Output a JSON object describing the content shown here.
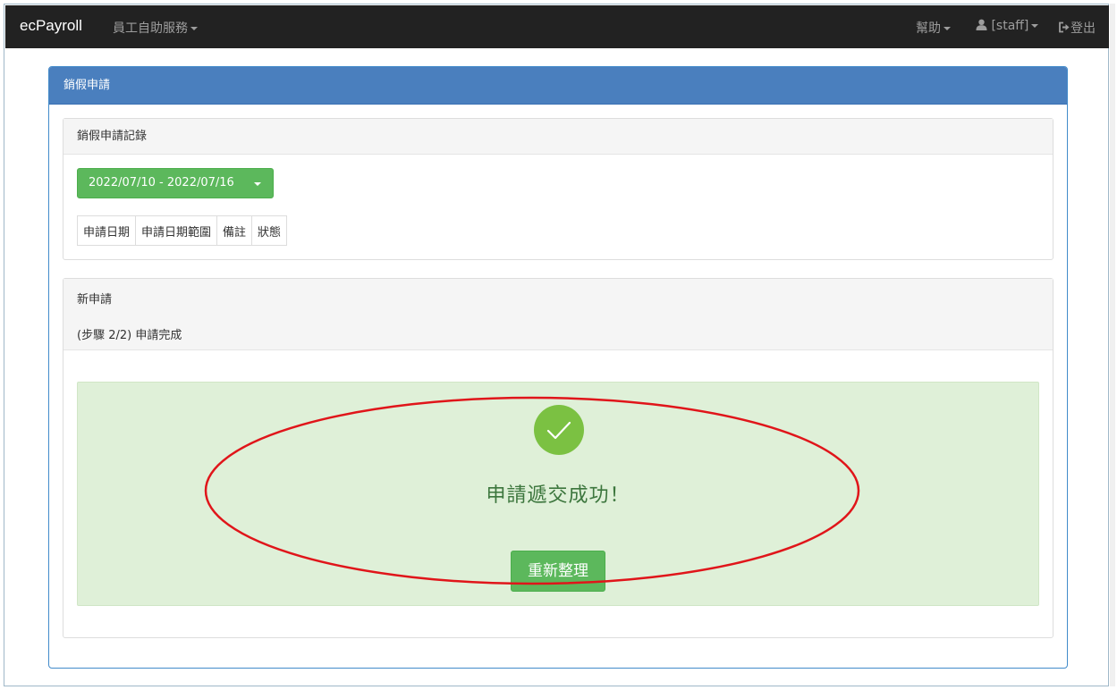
{
  "navbar": {
    "brand": "ecPayroll",
    "menu_self_service": "員工自助服務",
    "help": "幫助",
    "user": "[staff]",
    "logout": "登出"
  },
  "panel": {
    "title": "銷假申請",
    "records": {
      "title": "銷假申請記錄",
      "date_range": "2022/07/10 - 2022/07/16",
      "columns": [
        "申請日期",
        "申請日期範圍",
        "備註",
        "狀態"
      ]
    },
    "new_request": {
      "title": "新申請",
      "step": "(步驟 2/2) 申請完成",
      "success_message": "申請遞交成功！",
      "refresh_label": "重新整理"
    }
  },
  "colors": {
    "navbar": "#222222",
    "panel_heading": "#4a7fbe",
    "success_bg": "#dff0d8",
    "button_green": "#5cb85c",
    "check_green": "#7bc142",
    "annotation_red": "#e0151a"
  }
}
